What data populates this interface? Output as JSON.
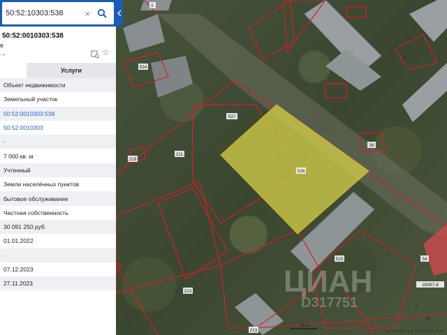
{
  "search": {
    "value": "50:52:10303:538",
    "clear_symbol": "×"
  },
  "header": {
    "title": "50:52:0010303:538",
    "sub_fragment": "е",
    "arrow_symbol": "→"
  },
  "tabs": [
    {
      "label": ""
    },
    {
      "label": "Услуги"
    }
  ],
  "details": [
    "Объект недвижимости",
    "Земельный участок",
    "50:52:0010303:538",
    "50:52:0010303",
    "-",
    "7 000 кв. м",
    "Учтенный",
    "Земли населённых пунктов",
    "бытовое обслуживание",
    "Частная собственность",
    "30 091 250 руб.",
    "01.01.2022",
    "-",
    "07.12.2023",
    "27.11.2023"
  ],
  "map": {
    "parcel_labels": [
      "538",
      "537",
      "211",
      "534",
      "219",
      "515",
      "213",
      "213",
      "5",
      "38",
      "54",
      "7",
      "35",
      "31"
    ],
    "scale_label": "30 м",
    "address_fragment": "18997-8",
    "attribution": "Гик Ф Энергостр 2010-2024 | Esri",
    "watermark": "ЦИАН",
    "watermark_id": "D317751",
    "edge_label": "03",
    "highlight_color": "#d6d24a",
    "boundary_color": "#d0202a"
  }
}
